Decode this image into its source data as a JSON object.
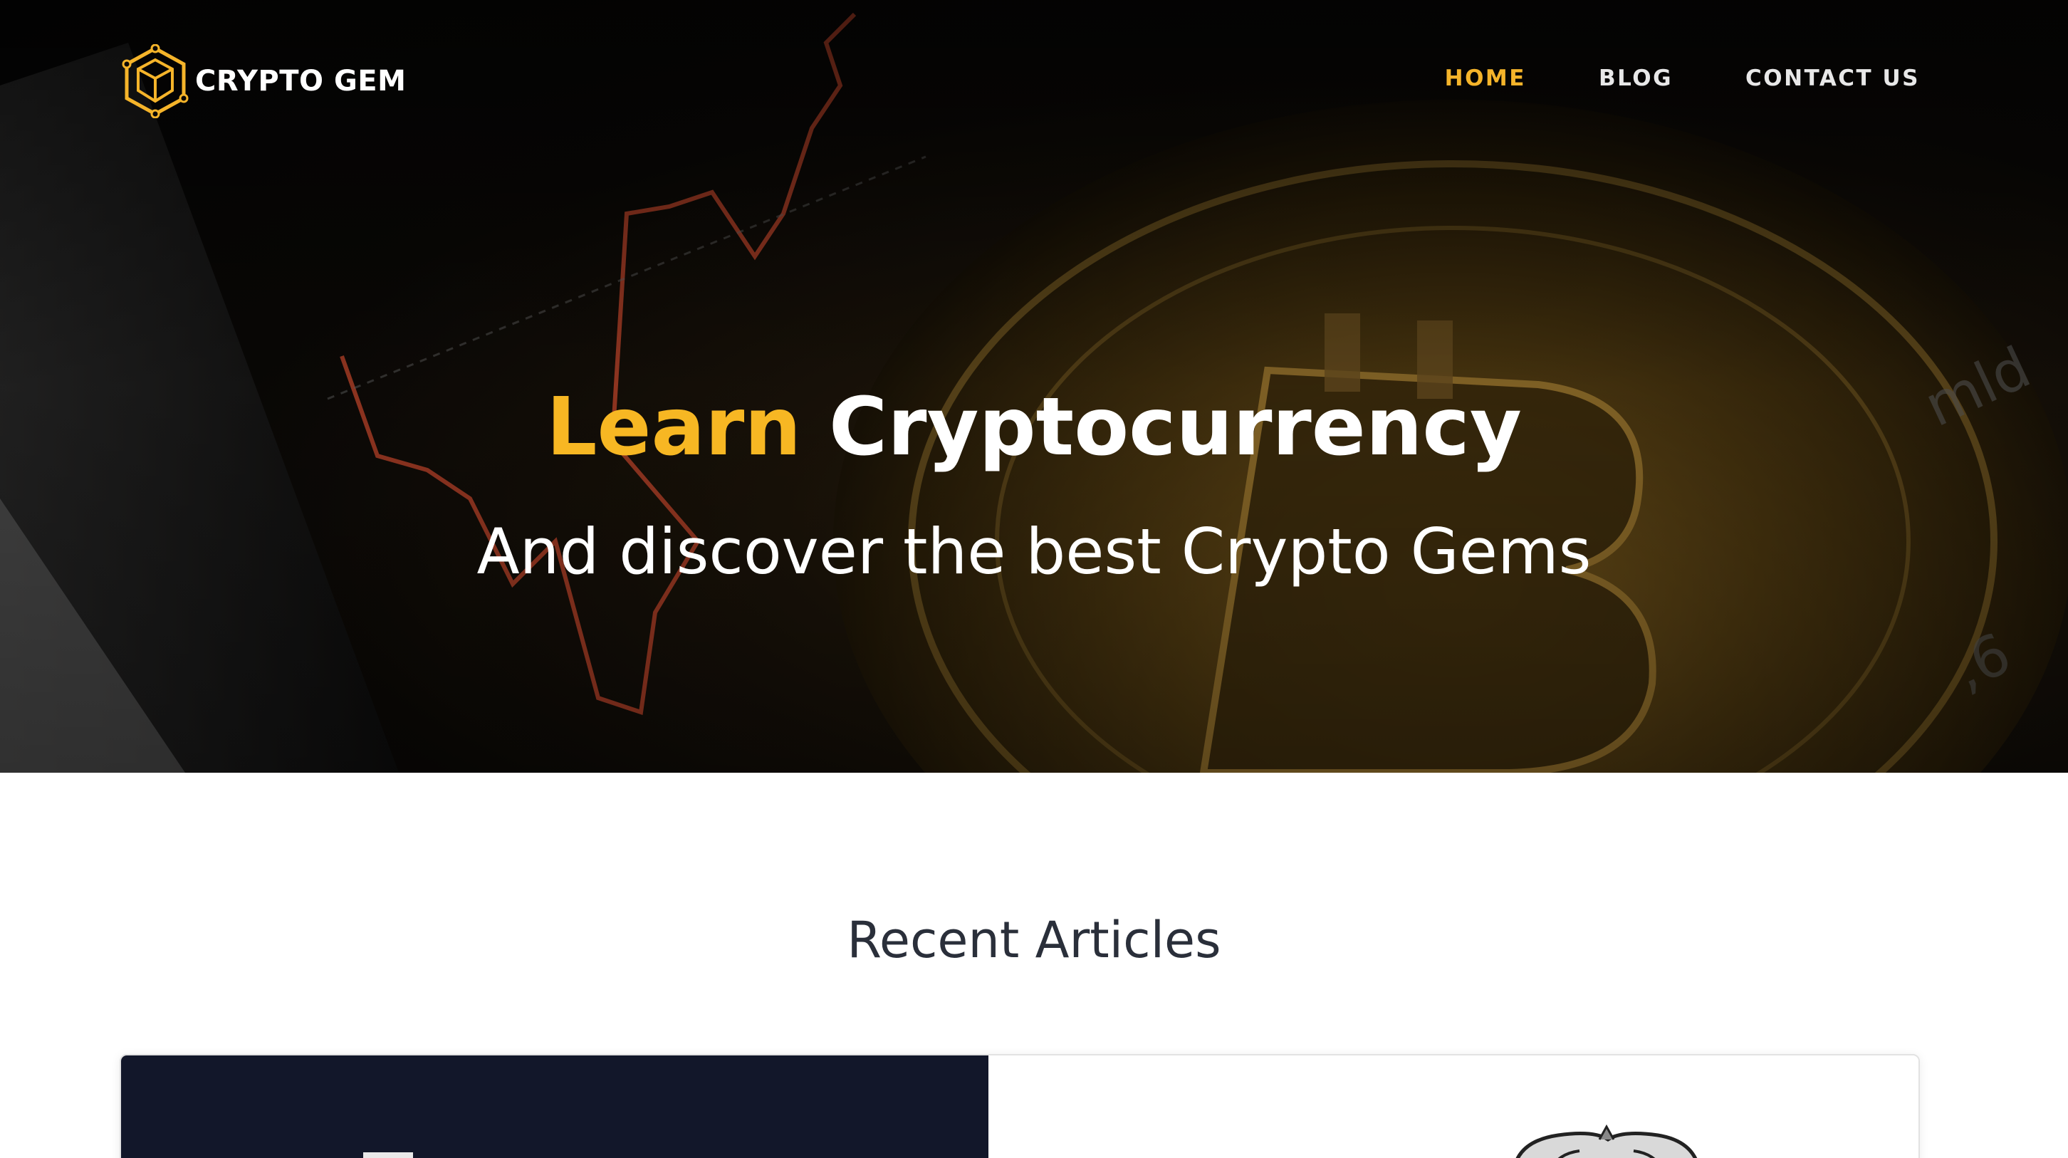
{
  "brand": {
    "name": "CRYPTO GEM",
    "accent_color": "#f5b42a",
    "logo_icon": "hexagon-cube-icon"
  },
  "nav": {
    "items": [
      {
        "label": "HOME",
        "active": true
      },
      {
        "label": "BLOG",
        "active": false
      },
      {
        "label": "CONTACT US",
        "active": false
      }
    ]
  },
  "hero": {
    "headline_accent": "Learn",
    "headline_rest": "Cryptocurrency",
    "subline": "And discover the best Crypto Gems"
  },
  "recent": {
    "title": "Recent Articles"
  }
}
